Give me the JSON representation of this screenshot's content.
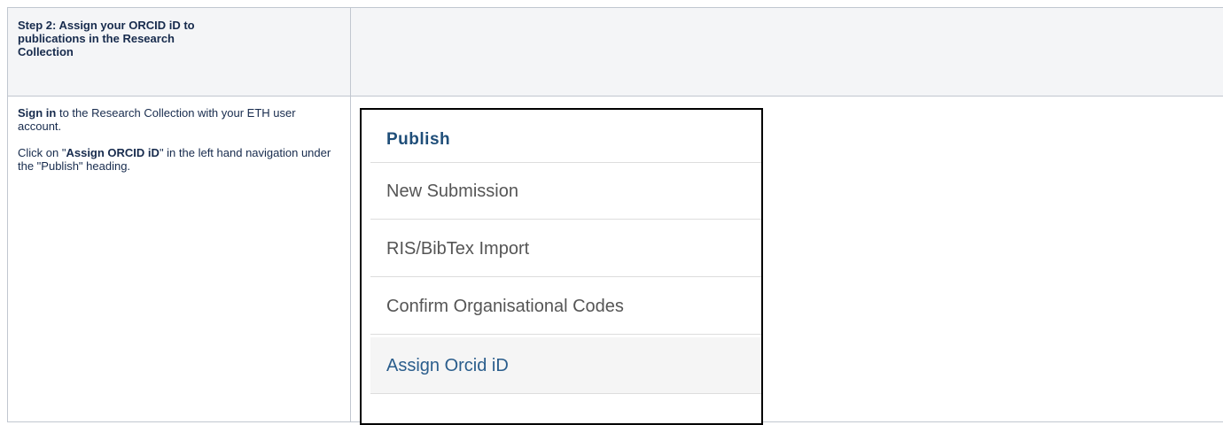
{
  "header": {
    "step_title": "Step 2: Assign your ORCID iD to publications in the Research Collection"
  },
  "instructions": {
    "p1_bold": "Sign in",
    "p1_rest": " to the Research Collection with your ETH user account.",
    "p2_pre": "Click on \"",
    "p2_bold": "Assign ORCID iD",
    "p2_post": "\" in the left hand navigation under the \"Publish\" heading."
  },
  "screenshot_menu": {
    "heading": "Publish",
    "items": [
      {
        "label": "New Submission"
      },
      {
        "label": "RIS/BibTex Import"
      },
      {
        "label": "Confirm Organisational Codes"
      },
      {
        "label": "Assign Orcid iD"
      }
    ],
    "colors": {
      "heading": "#1f4e79",
      "active_item": "#2a5d8c",
      "item": "#555555"
    }
  }
}
